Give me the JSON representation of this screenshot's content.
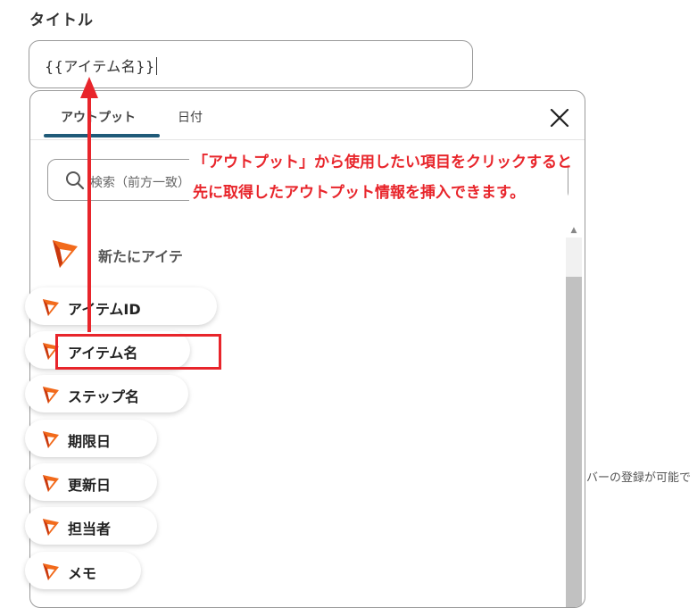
{
  "field": {
    "label": "タイトル",
    "value": "{{アイテム名}}"
  },
  "popup": {
    "tabs": [
      {
        "label": "アウトプット",
        "active": true
      },
      {
        "label": "日付",
        "active": false
      }
    ],
    "search_placeholder": "検索（前方一致）",
    "group": {
      "name": "新たにアイテ"
    },
    "items": [
      {
        "label": "アイテムID"
      },
      {
        "label": "アイテム名"
      },
      {
        "label": "ステップ名"
      },
      {
        "label": "期限日"
      },
      {
        "label": "更新日"
      },
      {
        "label": "担当者"
      },
      {
        "label": "メモ"
      }
    ]
  },
  "annotation": {
    "line1": "「アウトプット」から使用したい項目をクリックすると",
    "line2": "先に取得したアウトプット情報を挿入できます。"
  },
  "background_text": "バーの登録が可能で",
  "colors": {
    "accent_red": "#e8252b",
    "tab_underline": "#1f5a78",
    "logo_orange": "#f26a1b"
  },
  "icons": {
    "close": "close-icon",
    "search": "search-icon",
    "item": "app-logo-icon"
  }
}
